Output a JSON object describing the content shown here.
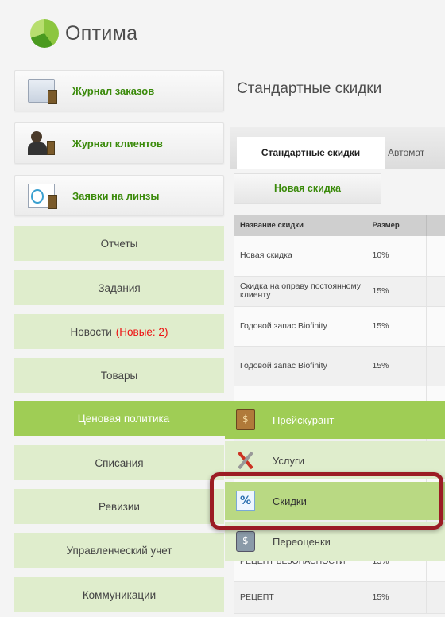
{
  "app": {
    "name": "Оптима"
  },
  "quick_buttons": [
    {
      "label": "Журнал заказов",
      "icon": "order-journal-icon"
    },
    {
      "label": "Журнал клиентов",
      "icon": "client-journal-icon"
    },
    {
      "label": "Заявки на линзы",
      "icon": "lens-requests-icon"
    }
  ],
  "menu": {
    "reports": "Отчеты",
    "tasks": "Задания",
    "news": "Новости",
    "news_badge": "(Новые: 2)",
    "goods": "Товары",
    "pricing": "Ценовая политика",
    "writeoffs": "Списания",
    "audits": "Ревизии",
    "management": "Управленческий учет",
    "communications": "Коммуникации"
  },
  "page": {
    "title": "Стандартные скидки",
    "tabs": [
      "Стандартные скидки",
      "Автомат"
    ],
    "new_button": "Новая скидка"
  },
  "table": {
    "columns": [
      "Название скидки",
      "Размер"
    ],
    "rows": [
      {
        "name": "Новая скидка",
        "size": "10%"
      },
      {
        "name": "Скидка на оправу постоянному клиенту",
        "size": "15%"
      },
      {
        "name": "Годовой запас Biofinity",
        "size": "15%"
      },
      {
        "name": "Годовой запас Biofinity",
        "size": "15%"
      },
      {
        "name": "",
        "size": ""
      },
      {
        "name": "",
        "size": ""
      },
      {
        "name": "",
        "size": ""
      },
      {
        "name": "",
        "size": ""
      },
      {
        "name": "РЕЦЕПТ БЕЗОПАСНОСТИ",
        "size": "15%"
      },
      {
        "name": "РЕЦЕПТ",
        "size": "15%"
      }
    ]
  },
  "submenu": {
    "items": [
      {
        "label": "Прейскурант",
        "icon": "price-list-icon"
      },
      {
        "label": "Услуги",
        "icon": "services-icon"
      },
      {
        "label": "Скидки",
        "icon": "discount-icon"
      },
      {
        "label": "Переоценки",
        "icon": "revaluation-icon"
      }
    ]
  },
  "colors": {
    "brand_green": "#3a8a0a",
    "menu_bg": "#dfedcc",
    "menu_active": "#9fcd55",
    "badge_red": "#ee1111",
    "highlight": "#9b1c24"
  }
}
